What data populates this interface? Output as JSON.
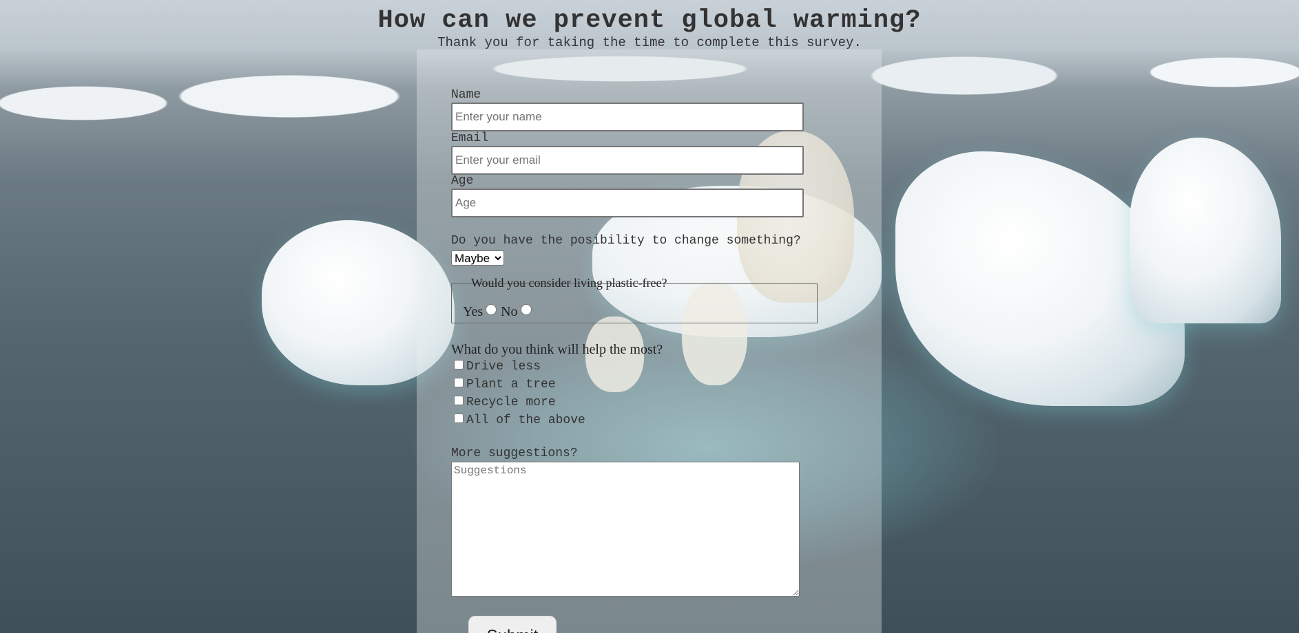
{
  "header": {
    "title": "How can we prevent global warming?",
    "subtitle": "Thank you for taking the time to complete this survey."
  },
  "form": {
    "name": {
      "label": "Name",
      "placeholder": "Enter your name",
      "value": ""
    },
    "email": {
      "label": "Email",
      "placeholder": "Enter your email",
      "value": ""
    },
    "age": {
      "label": "Age",
      "placeholder": "Age",
      "value": ""
    },
    "possibility": {
      "label": "Do you have the posibility to change something?",
      "selected": "Maybe"
    },
    "plastic_free": {
      "legend": "Would you consider living plastic-free?",
      "options": [
        "Yes",
        "No"
      ]
    },
    "help_most": {
      "label": "What do you think will help the most?",
      "options": [
        "Drive less",
        "Plant a tree",
        "Recycle more",
        "All of the above"
      ]
    },
    "suggestions": {
      "label": "More suggestions?",
      "placeholder": "Suggestions"
    },
    "submit_label": "Submit"
  },
  "icons": {
    "select": "chevron-down-icon",
    "textarea": "resize-grip-icon"
  }
}
